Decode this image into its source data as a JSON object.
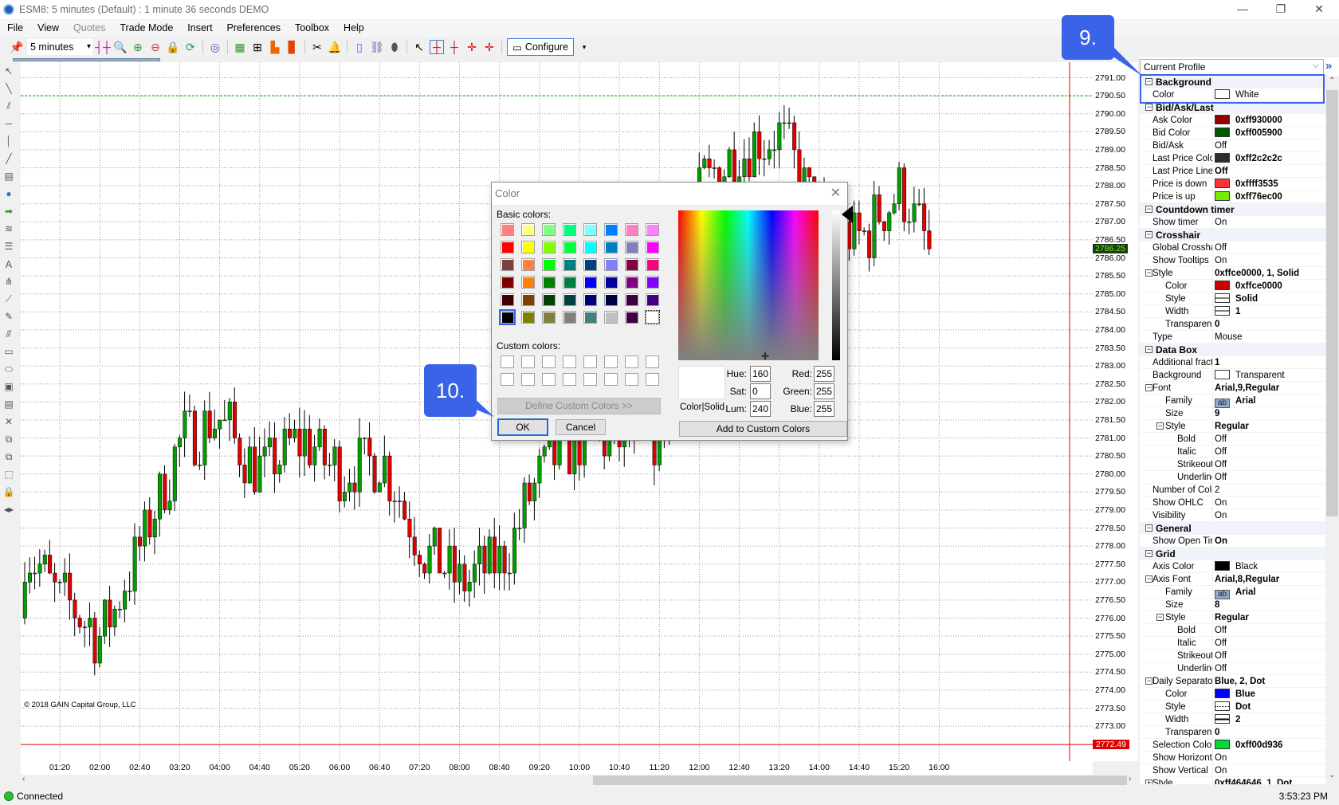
{
  "window": {
    "title": "ESM8: 5 minutes (Default) : 1 minute 36 seconds DEMO",
    "controls": [
      "minimize",
      "restore",
      "close"
    ]
  },
  "menu": [
    {
      "label": "File",
      "enabled": true
    },
    {
      "label": "View",
      "enabled": true
    },
    {
      "label": "Quotes",
      "enabled": false
    },
    {
      "label": "Trade Mode",
      "enabled": true
    },
    {
      "label": "Insert",
      "enabled": true
    },
    {
      "label": "Preferences",
      "enabled": true
    },
    {
      "label": "Toolbox",
      "enabled": true
    },
    {
      "label": "Help",
      "enabled": true
    }
  ],
  "toolbar": {
    "interval": "5 minutes",
    "configure_label": "Configure"
  },
  "chart": {
    "copyright": "© 2018 GAIN Capital Group, LLC",
    "price_labels": [
      "2791.00",
      "2790.50",
      "2790.00",
      "2789.50",
      "2789.00",
      "2788.50",
      "2788.00",
      "2787.50",
      "2787.00",
      "2786.50",
      "2786.00",
      "2785.50",
      "2785.00",
      "2784.50",
      "2784.00",
      "2783.50",
      "2783.00",
      "2782.50",
      "2782.00",
      "2781.50",
      "2781.00",
      "2780.50",
      "2780.00",
      "2779.50",
      "2779.00",
      "2778.50",
      "2778.00",
      "2777.50",
      "2777.00",
      "2776.50",
      "2776.00",
      "2775.50",
      "2775.00",
      "2774.50",
      "2774.00",
      "2773.50",
      "2773.00"
    ],
    "time_labels": [
      "01:20",
      "02:00",
      "02:40",
      "03:20",
      "04:00",
      "04:40",
      "05:20",
      "06:00",
      "06:40",
      "07:20",
      "08:00",
      "08:40",
      "09:20",
      "10:00",
      "10:40",
      "11:20",
      "12:00",
      "12:40",
      "13:20",
      "14:00",
      "14:40",
      "15:20",
      "16:00"
    ],
    "last_price": "2786.25",
    "red_line_price": "2772.49",
    "green_line_price": "2790.50",
    "approx_price_path": [
      2776.5,
      2775.5,
      2778.0,
      2781.0,
      2781.5,
      2780.0,
      2781.0,
      2780.0,
      2780.5,
      2778.0,
      2777.0,
      2777.5,
      2780.0,
      2781.0,
      2781.0,
      2781.0,
      2788.0,
      2789.0,
      2789.5,
      2787.0,
      2786.5,
      2788.0,
      2785.3
    ],
    "colors": {
      "up": "#00a000",
      "down": "#e00000",
      "last_price_bg": "#1a3a1a",
      "last_price_fg": "#76ec00",
      "red_line": "#e00000",
      "green_line": "#00a000"
    }
  },
  "status": {
    "connection": "Connected",
    "time": "3:53:23 PM"
  },
  "panel": {
    "profile": "Current Profile",
    "rows": [
      {
        "t": "cat",
        "label": "Background",
        "exp": "-"
      },
      {
        "t": "prop",
        "lv": 0,
        "label": "Color",
        "swatch": "#ffffff",
        "value": "White"
      },
      {
        "t": "cat",
        "label": "Bid/Ask/Last",
        "exp": "-"
      },
      {
        "t": "prop",
        "lv": 0,
        "label": "Ask Color",
        "swatch": "#930000",
        "value": "0xff930000",
        "b": true
      },
      {
        "t": "prop",
        "lv": 0,
        "label": "Bid Color",
        "swatch": "#005900",
        "value": "0xff005900",
        "b": true
      },
      {
        "t": "prop",
        "lv": 0,
        "label": "Bid/Ask",
        "value": "Off"
      },
      {
        "t": "prop",
        "lv": 0,
        "label": "Last Price Colo",
        "swatch": "#2c2c2c",
        "value": "0xff2c2c2c",
        "b": true
      },
      {
        "t": "prop",
        "lv": 0,
        "label": "Last Price Line",
        "value": "Off",
        "b": true
      },
      {
        "t": "prop",
        "lv": 0,
        "label": "Price is down",
        "swatch": "#ff3535",
        "value": "0xffff3535",
        "b": true
      },
      {
        "t": "prop",
        "lv": 0,
        "label": "Price is up",
        "swatch": "#76ec00",
        "value": "0xff76ec00",
        "b": true
      },
      {
        "t": "cat",
        "label": "Countdown timer",
        "exp": "-"
      },
      {
        "t": "prop",
        "lv": 0,
        "label": "Show timer",
        "value": "On"
      },
      {
        "t": "cat",
        "label": "Crosshair",
        "exp": "-"
      },
      {
        "t": "prop",
        "lv": 0,
        "label": "Global Crossha",
        "value": "Off"
      },
      {
        "t": "prop",
        "lv": 0,
        "label": "Show Tooltips",
        "value": "On"
      },
      {
        "t": "prop",
        "lv": 0,
        "label": "Style",
        "exp": "-",
        "value": "0xffce0000, 1, Solid",
        "b": true
      },
      {
        "t": "prop",
        "lv": 1,
        "label": "Color",
        "swatch": "#ce0000",
        "value": "0xffce0000",
        "b": true
      },
      {
        "t": "prop",
        "lv": 1,
        "label": "Style",
        "swatch": "line",
        "value": "Solid",
        "b": true
      },
      {
        "t": "prop",
        "lv": 1,
        "label": "Width",
        "swatch": "line",
        "value": "1",
        "b": true
      },
      {
        "t": "prop",
        "lv": 1,
        "label": "Transparenc",
        "value": "0",
        "b": true
      },
      {
        "t": "prop",
        "lv": 0,
        "label": "Type",
        "value": "Mouse"
      },
      {
        "t": "cat",
        "label": "Data Box",
        "exp": "-"
      },
      {
        "t": "prop",
        "lv": 0,
        "label": "Additional fract",
        "value": "1",
        "b": true
      },
      {
        "t": "prop",
        "lv": 0,
        "label": "Background",
        "swatch": "#ffffff",
        "value": "Transparent"
      },
      {
        "t": "prop",
        "lv": 0,
        "label": "Font",
        "exp": "-",
        "value": "Arial,9,Regular",
        "b": true
      },
      {
        "t": "prop",
        "lv": 1,
        "label": "Family",
        "swatch": "ab",
        "value": "Arial",
        "b": true
      },
      {
        "t": "prop",
        "lv": 1,
        "label": "Size",
        "value": "9",
        "b": true
      },
      {
        "t": "prop",
        "lv": 1,
        "label": "Style",
        "exp": "-",
        "value": "Regular",
        "b": true
      },
      {
        "t": "prop",
        "lv": 2,
        "label": "Bold",
        "value": "Off"
      },
      {
        "t": "prop",
        "lv": 2,
        "label": "Italic",
        "value": "Off"
      },
      {
        "t": "prop",
        "lv": 2,
        "label": "Strikeout",
        "value": "Off"
      },
      {
        "t": "prop",
        "lv": 2,
        "label": "Underline",
        "value": "Off"
      },
      {
        "t": "prop",
        "lv": 0,
        "label": "Number of Colu",
        "value": "2"
      },
      {
        "t": "prop",
        "lv": 0,
        "label": "Show OHLC",
        "value": "On"
      },
      {
        "t": "prop",
        "lv": 0,
        "label": "Visibility",
        "value": "On"
      },
      {
        "t": "cat",
        "label": "General",
        "exp": "-"
      },
      {
        "t": "prop",
        "lv": 0,
        "label": "Show Open Tir",
        "value": "On",
        "b": true
      },
      {
        "t": "cat",
        "label": "Grid",
        "exp": "-"
      },
      {
        "t": "prop",
        "lv": 0,
        "label": "Axis Color",
        "swatch": "#000000",
        "value": "Black"
      },
      {
        "t": "prop",
        "lv": 0,
        "label": "Axis Font",
        "exp": "-",
        "value": "Arial,8,Regular",
        "b": true
      },
      {
        "t": "prop",
        "lv": 1,
        "label": "Family",
        "swatch": "ab",
        "value": "Arial",
        "b": true
      },
      {
        "t": "prop",
        "lv": 1,
        "label": "Size",
        "value": "8",
        "b": true
      },
      {
        "t": "prop",
        "lv": 1,
        "label": "Style",
        "exp": "-",
        "value": "Regular",
        "b": true
      },
      {
        "t": "prop",
        "lv": 2,
        "label": "Bold",
        "value": "Off"
      },
      {
        "t": "prop",
        "lv": 2,
        "label": "Italic",
        "value": "Off"
      },
      {
        "t": "prop",
        "lv": 2,
        "label": "Strikeout",
        "value": "Off"
      },
      {
        "t": "prop",
        "lv": 2,
        "label": "Underline",
        "value": "Off"
      },
      {
        "t": "prop",
        "lv": 0,
        "label": "Daily Separator",
        "exp": "-",
        "value": "Blue, 2, Dot",
        "b": true
      },
      {
        "t": "prop",
        "lv": 1,
        "label": "Color",
        "swatch": "#0000ff",
        "value": "Blue",
        "b": true
      },
      {
        "t": "prop",
        "lv": 1,
        "label": "Style",
        "swatch": "dot",
        "value": "Dot",
        "b": true
      },
      {
        "t": "prop",
        "lv": 1,
        "label": "Width",
        "swatch": "line2",
        "value": "2",
        "b": true
      },
      {
        "t": "prop",
        "lv": 1,
        "label": "Transparenc",
        "value": "0",
        "b": true
      },
      {
        "t": "prop",
        "lv": 0,
        "label": "Selection Color",
        "swatch": "#00d936",
        "value": "0xff00d936",
        "b": true
      },
      {
        "t": "prop",
        "lv": 0,
        "label": "Show Horizont",
        "value": "On"
      },
      {
        "t": "prop",
        "lv": 0,
        "label": "Show Vertical",
        "value": "On"
      },
      {
        "t": "prop",
        "lv": 0,
        "label": "Style",
        "exp": "+",
        "value": "0xff464646, 1, Dot",
        "b": true
      }
    ]
  },
  "callouts": {
    "step9": "9.",
    "step10": "10."
  },
  "dialog": {
    "title": "Color",
    "basic_label": "Basic colors:",
    "basic_colors": [
      "#ff8080",
      "#ffff80",
      "#80ff80",
      "#00ff80",
      "#80ffff",
      "#0080ff",
      "#ff80c0",
      "#ff80ff",
      "#ff0000",
      "#ffff00",
      "#80ff00",
      "#00ff40",
      "#00ffff",
      "#0080c0",
      "#8080c0",
      "#ff00ff",
      "#804040",
      "#ff8040",
      "#00ff00",
      "#008080",
      "#004080",
      "#8080ff",
      "#800040",
      "#ff0080",
      "#800000",
      "#ff8000",
      "#008000",
      "#008040",
      "#0000ff",
      "#0000a0",
      "#800080",
      "#8000ff",
      "#400000",
      "#804000",
      "#004000",
      "#004040",
      "#000080",
      "#000040",
      "#400040",
      "#400080",
      "#000000",
      "#808000",
      "#808040",
      "#808080",
      "#408080",
      "#c0c0c0",
      "#400040",
      "#ffffff"
    ],
    "selected_basic": "#ffffff",
    "custom_label": "Custom colors:",
    "define_label": "Define Custom Colors >>",
    "ok_label": "OK",
    "cancel_label": "Cancel",
    "preview_label": "Color|Solid",
    "hue_label": "Hue:",
    "hue": "160",
    "sat_label": "Sat:",
    "sat": "0",
    "lum_label": "Lum:",
    "lum": "240",
    "red_label": "Red:",
    "red": "255",
    "green_label": "Green:",
    "green": "255",
    "blue_label": "Blue:",
    "blue": "255",
    "add_label": "Add to Custom Colors"
  }
}
